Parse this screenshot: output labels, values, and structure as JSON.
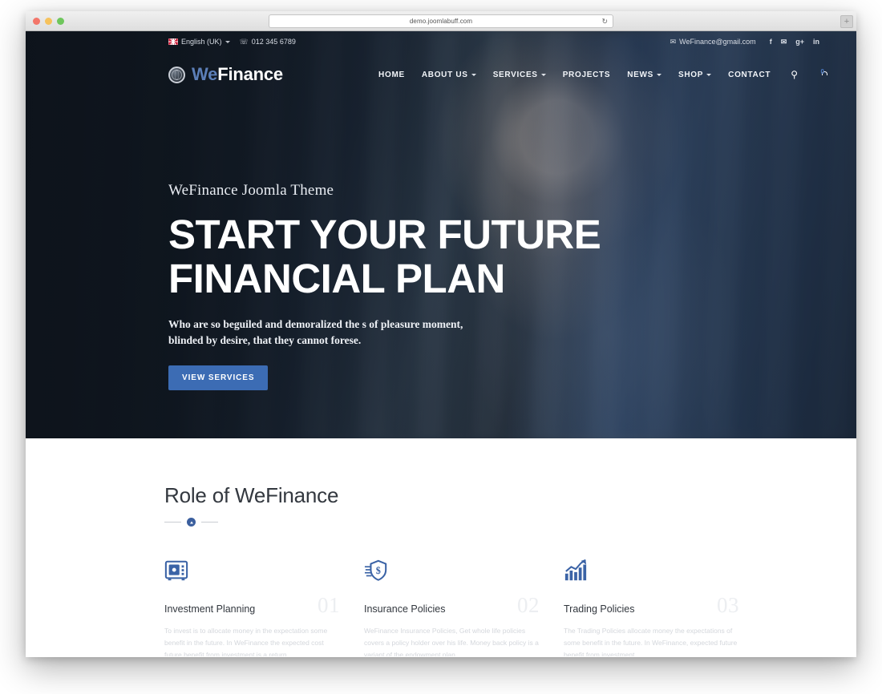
{
  "browser": {
    "url": "demo.joomlabuff.com",
    "reload_icon": "reload-icon",
    "new_tab_label": "+",
    "traffic_lights": [
      "close",
      "minimize",
      "maximize"
    ]
  },
  "topbar": {
    "language": "English (UK)",
    "language_flag": "uk-flag-icon",
    "phone_icon": "phone-icon",
    "phone": "012 345 6789",
    "email_icon": "envelope-icon",
    "email": "WeFinance@gmail.com",
    "social": [
      {
        "name": "facebook-icon",
        "glyph": "f"
      },
      {
        "name": "twitter-icon",
        "glyph": "✉"
      },
      {
        "name": "google-plus-icon",
        "glyph": "g+"
      },
      {
        "name": "linkedin-icon",
        "glyph": "in"
      }
    ]
  },
  "logo": {
    "icon": "globe-logo-icon",
    "part_one": "We",
    "part_two": "Finance",
    "accent_color": "#5c7fb8"
  },
  "nav": {
    "items": [
      {
        "label": "HOME",
        "has_dropdown": false
      },
      {
        "label": "ABOUT US",
        "has_dropdown": true
      },
      {
        "label": "SERVICES",
        "has_dropdown": true
      },
      {
        "label": "PROJECTS",
        "has_dropdown": false
      },
      {
        "label": "NEWS",
        "has_dropdown": true
      },
      {
        "label": "SHOP",
        "has_dropdown": true
      },
      {
        "label": "CONTACT",
        "has_dropdown": false
      }
    ],
    "search_icon": "search-icon",
    "cart_icon": "shopping-cart-icon",
    "cart_count": "0"
  },
  "hero": {
    "eyebrow": "WeFinance Joomla Theme",
    "title_line_1": "START YOUR FUTURE",
    "title_line_2": "FINANCIAL PLAN",
    "subtitle": "Who are so beguiled and demoralized the s of pleasure moment, blinded by desire, that they cannot forese.",
    "cta_label": "VIEW SERVICES",
    "cta_color": "#3c6cb4"
  },
  "role_section": {
    "heading": "Role of WeFinance",
    "divider_icon": "badge-divider-icon",
    "cards": [
      {
        "icon": "safe-vault-icon",
        "title": "Investment Planning",
        "number": "01",
        "body": "To invest is to allocate money in the expectation some benefit in the future. In WeFinance the expected cost future benefit from investment is a return."
      },
      {
        "icon": "shield-dollar-icon",
        "title": "Insurance Policies",
        "number": "02",
        "body": "WeFinance Insurance Policies, Get whole life policies covers a policy holder over his life. Money back policy is a variant of the endowment plan."
      },
      {
        "icon": "growth-chart-icon",
        "title": "Trading Policies",
        "number": "03",
        "body": "The Trading Policies allocate money the expectations of some benefit in the future. In WeFinance, expected future benefit from investment."
      }
    ]
  }
}
